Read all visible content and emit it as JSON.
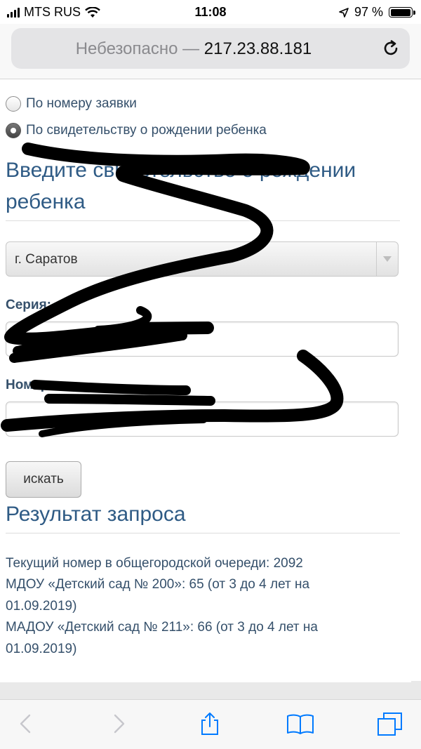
{
  "status_bar": {
    "carrier": "MTS RUS",
    "time": "11:08",
    "battery": "97 %",
    "battery_level": 0.97
  },
  "address_bar": {
    "insecure_label": "Небезопасно —",
    "host": "217.23.88.181"
  },
  "search_mode": {
    "options": [
      {
        "label": "По номеру заявки",
        "checked": false
      },
      {
        "label": "По свидетельству о рождении ребенка",
        "checked": true
      }
    ]
  },
  "form": {
    "heading": "Введите свидетельство о рождении ребенка",
    "city_select": {
      "value": "г. Саратов"
    },
    "series_label": "Серия:",
    "series_value": "",
    "number_label": "Номер:",
    "number_value": "",
    "search_button": "искать"
  },
  "result": {
    "heading": "Результат запроса",
    "lines": [
      "Текущий номер в общегородской очереди: 2092",
      "МДОУ «Детский сад № 200»: 65 (от 3 до 4 лет на",
      "01.09.2019)",
      "МАДОУ «Детский сад № 211»: 66 (от 3 до 4 лет на",
      "01.09.2019)"
    ]
  },
  "toolbar": {
    "icons": [
      "back-arrow-icon",
      "forward-arrow-icon",
      "share-icon",
      "bookmarks-icon",
      "tabs-icon"
    ]
  },
  "colors": {
    "link_text": "#35506b",
    "heading_text": "#2f5b85",
    "ios_blue": "#007aff",
    "scribble": "#000000"
  }
}
